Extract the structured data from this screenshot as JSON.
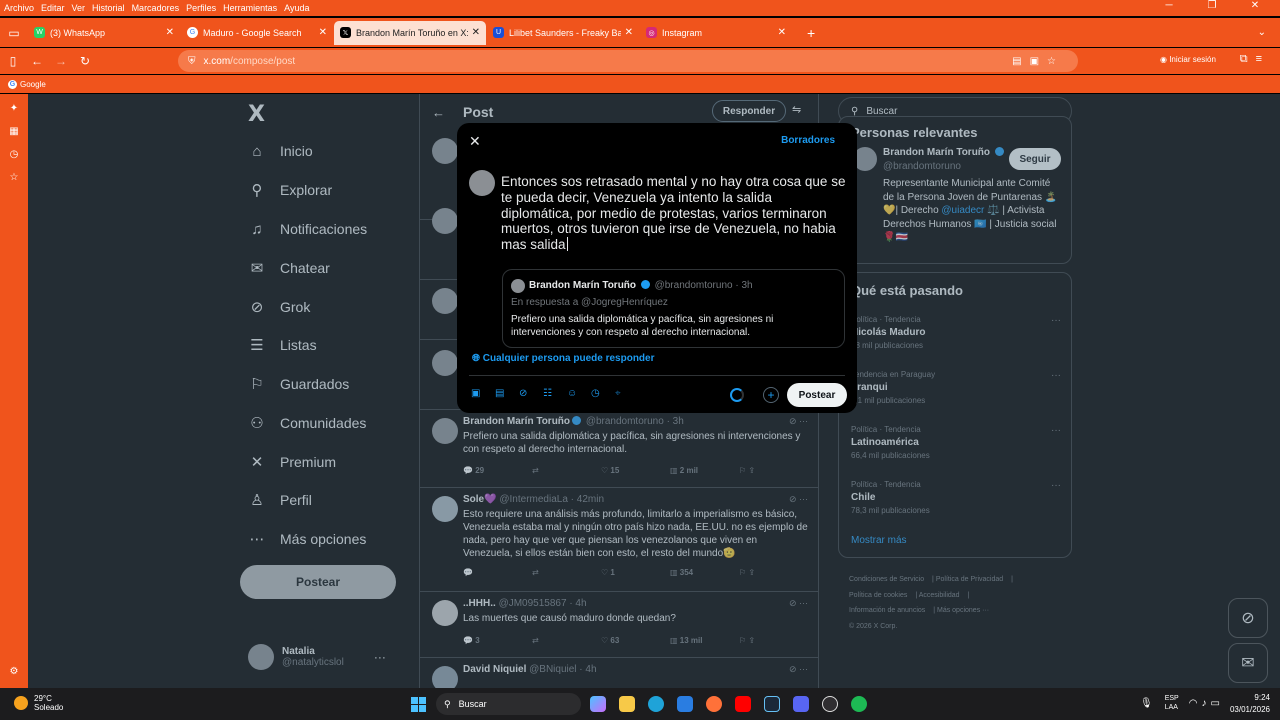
{
  "browser": {
    "menu": [
      "Archivo",
      "Editar",
      "Ver",
      "Historial",
      "Marcadores",
      "Perfiles",
      "Herramientas",
      "Ayuda"
    ],
    "tabs": [
      {
        "title": "(3) WhatsApp",
        "color": "#25d366",
        "active": false
      },
      {
        "title": "Maduro - Google Search",
        "color": "#4285f4",
        "active": false
      },
      {
        "title": "Brandon Marín Toruño en X: \"El",
        "color": "#000000",
        "active": true
      },
      {
        "title": "Lilibet Saunders - Freaky Baddie",
        "color": "#1a4fd8",
        "active": false
      },
      {
        "title": "Instagram",
        "color": "#d62976",
        "active": false
      }
    ],
    "url_host": "x.com",
    "url_path": "/compose/post",
    "login_label": "Iniciar sesión",
    "bookmark": "Google"
  },
  "leftnav": {
    "logo": "X",
    "items": [
      {
        "label": "Inicio",
        "icon": "home-icon",
        "glyph": "⌂"
      },
      {
        "label": "Explorar",
        "icon": "search-icon",
        "glyph": "⚲"
      },
      {
        "label": "Notificaciones",
        "icon": "bell-icon",
        "glyph": "♫"
      },
      {
        "label": "Chatear",
        "icon": "mail-icon",
        "glyph": "✉"
      },
      {
        "label": "Grok",
        "icon": "grok-icon",
        "glyph": "⊘"
      },
      {
        "label": "Listas",
        "icon": "list-icon",
        "glyph": "☰"
      },
      {
        "label": "Guardados",
        "icon": "bookmark-icon",
        "glyph": "⚐"
      },
      {
        "label": "Comunidades",
        "icon": "people-icon",
        "glyph": "⚇"
      },
      {
        "label": "Premium",
        "icon": "x-icon",
        "glyph": "✕"
      },
      {
        "label": "Perfil",
        "icon": "person-icon",
        "glyph": "♙"
      },
      {
        "label": "Más opciones",
        "icon": "more-icon",
        "glyph": "⋯"
      }
    ],
    "post_label": "Postear",
    "user_name": "Natalia",
    "user_handle": "@natalyticslol"
  },
  "main": {
    "title": "Post",
    "reply_label": "Responder",
    "tweets": [
      {
        "name": "Brandon Marín Toruño",
        "handle": "@brandomtoruno · 3h",
        "text": "Prefiero una salida diplomática y pacífica, sin agresiones ni intervenciones y con respeto al derecho internacional.",
        "replies": "29",
        "reposts": "",
        "likes": "15",
        "views": "2 mil"
      },
      {
        "name": "Sole💜",
        "handle": "@IntermediaLa · 42min",
        "text": "Esto requiere una análisis más profundo, limitarlo a imperialismo es básico, Venezuela estaba mal y ningún otro país hizo nada, EE.UU. no es ejemplo de nada, pero hay que ver que piensan los venezolanos que viven en Venezuela, si ellos están bien con esto, el resto del mundo🫡",
        "replies": "",
        "reposts": "",
        "likes": "1",
        "views": "354"
      },
      {
        "name": "..HHH..",
        "handle": "@JM09515867 · 4h",
        "text": "Las muertes que causó maduro donde quedan?",
        "replies": "3",
        "reposts": "",
        "likes": "63",
        "views": "13 mil"
      },
      {
        "name": "David Niquiel",
        "handle": "@BNiquiel · 4h",
        "text": "",
        "replies": "",
        "reposts": "",
        "likes": "",
        "views": ""
      }
    ]
  },
  "right": {
    "search_placeholder": "Buscar",
    "relevant_title": "Personas relevantes",
    "rel_name": "Brandon Marín Toruño",
    "rel_handle": "@brandomtoruno",
    "follow_label": "Seguir",
    "rel_bio_1": "Representante Municipal ante Comité de la Persona Joven de Puntarenas 🏝️💛| Derecho",
    "rel_bio_link": "@uiadecr",
    "rel_bio_2": "⚖️ | Activista Derechos Humanos 🇺🇳 | Justicia social 🌹🇨🇷",
    "trends_title": "Qué está pasando",
    "trends": [
      {
        "context": "Política · Tendencia",
        "name": "Nicolás Maduro",
        "count": "78 mil publicaciones"
      },
      {
        "context": "Tendencia en Paraguay",
        "name": "Franqui",
        "count": "1,1 mil publicaciones"
      },
      {
        "context": "Política · Tendencia",
        "name": "Latinoamérica",
        "count": "66,4 mil publicaciones"
      },
      {
        "context": "Política · Tendencia",
        "name": "Chile",
        "count": "78,3 mil publicaciones"
      }
    ],
    "show_more": "Mostrar más",
    "footer": [
      "Condiciones de Servicio",
      "Política de Privacidad",
      "Política de cookies",
      "Accesibilidad",
      "Información de anuncios",
      "Más opciones ···",
      "© 2026 X Corp."
    ]
  },
  "modal": {
    "drafts_label": "Borradores",
    "compose_text": "Entonces sos retrasado mental y no hay otra cosa que se te pueda decir, Venezuela ya intento la salida diplomática, por medio de protestas, varios terminaron muertos, otros tuvieron que irse de Venezuela, no habia mas salida",
    "quote_name": "Brandon Marín Toruño",
    "quote_handle": "@brandomtoruno · 3h",
    "quote_reply": "En respuesta a @JogregHenríquez",
    "quote_text": "Prefiero una salida diplomática y pacífica, sin agresiones ni intervenciones y con respeto al derecho internacional.",
    "who_can_reply": "Cualquier persona puede responder",
    "post_label": "Postear"
  },
  "taskbar": {
    "temp": "29°C",
    "weather": "Soleado",
    "search_label": "Buscar",
    "lang_1": "ESP",
    "lang_2": "LAA",
    "time": "9:24",
    "date": "03/01/2026"
  }
}
